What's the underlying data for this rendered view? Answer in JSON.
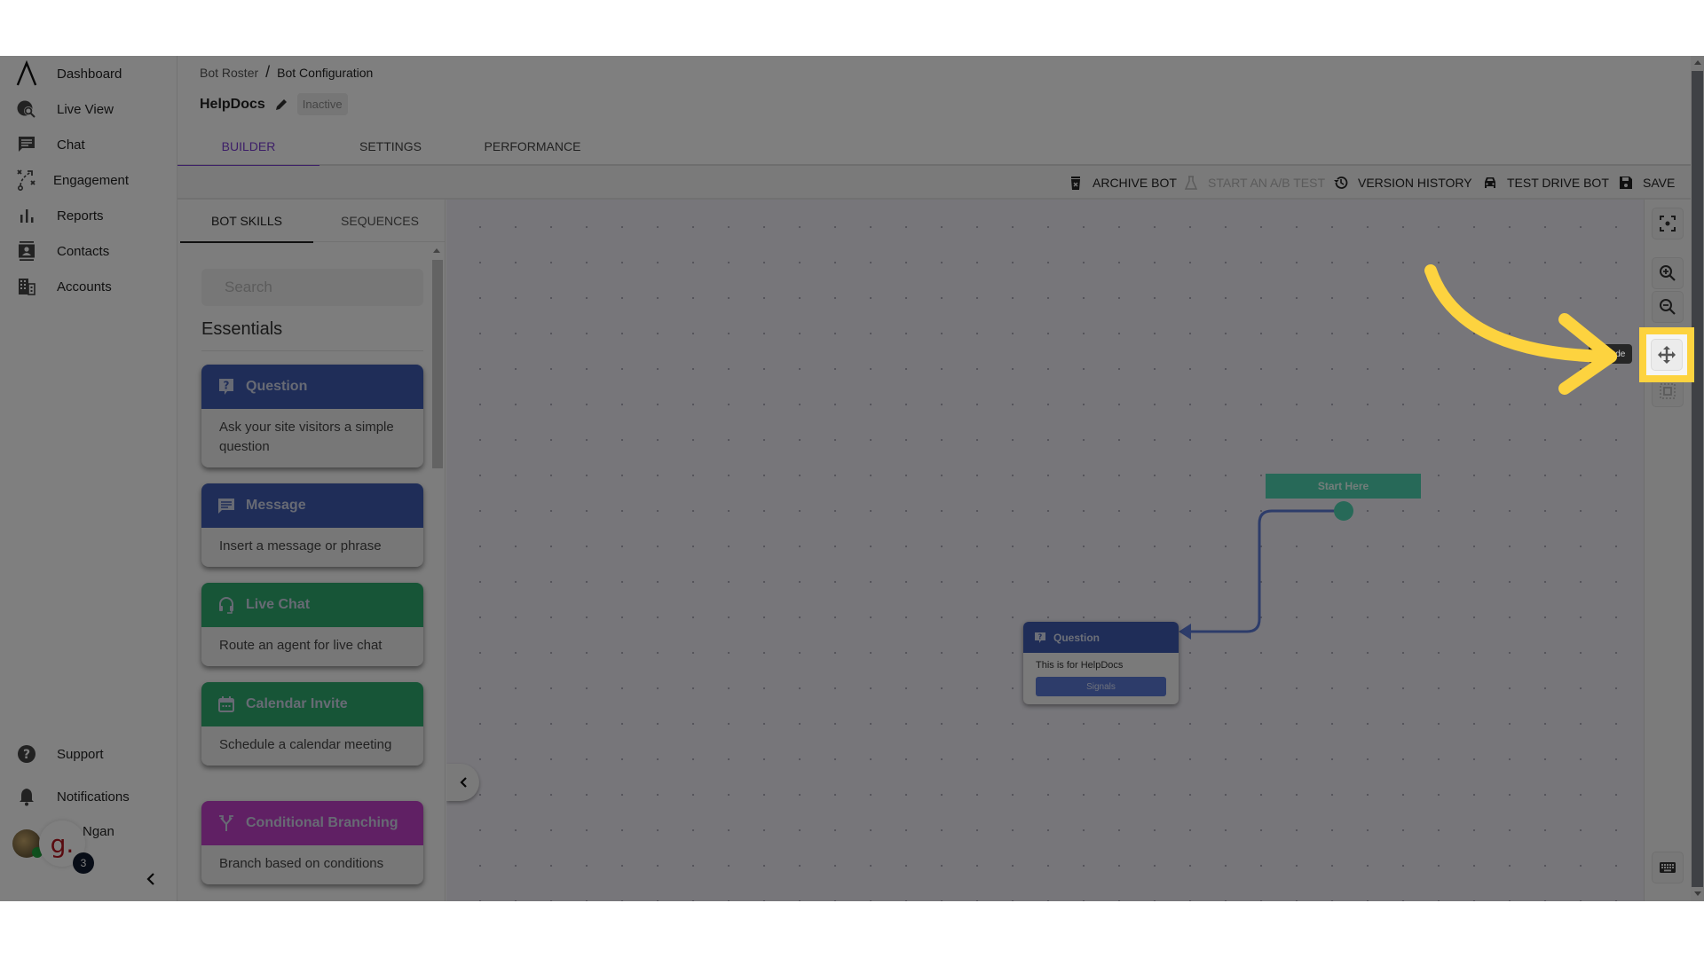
{
  "sidebar": {
    "items": [
      {
        "label": "Dashboard",
        "icon": "logo-icon"
      },
      {
        "label": "Live View",
        "icon": "globe-search-icon"
      },
      {
        "label": "Chat",
        "icon": "chat-icon"
      },
      {
        "label": "Engagement",
        "icon": "strategy-icon"
      },
      {
        "label": "Reports",
        "icon": "bar-chart-icon"
      },
      {
        "label": "Contacts",
        "icon": "contact-card-icon"
      },
      {
        "label": "Accounts",
        "icon": "building-icon"
      }
    ],
    "bottom": [
      {
        "label": "Support",
        "icon": "help-icon"
      },
      {
        "label": "Notifications",
        "icon": "bell-icon"
      }
    ],
    "user": {
      "name": "Ngan",
      "brand_letter": "g.",
      "badge_count": "3"
    },
    "collapse_glyph": "‹"
  },
  "header": {
    "breadcrumb": [
      "Bot Roster",
      "Bot Configuration"
    ],
    "breadcrumb_separator": "/",
    "bot_name": "HelpDocs",
    "status": "Inactive"
  },
  "tabs": [
    {
      "label": "BUILDER",
      "active": true
    },
    {
      "label": "SETTINGS",
      "active": false
    },
    {
      "label": "PERFORMANCE",
      "active": false
    }
  ],
  "toolbar": {
    "archive": "ARCHIVE BOT",
    "ab_test": "START AN A/B TEST",
    "version_history": "VERSION HISTORY",
    "test_drive": "TEST DRIVE BOT",
    "save": "SAVE"
  },
  "skills_panel": {
    "tabs": [
      {
        "label": "BOT SKILLS",
        "active": true
      },
      {
        "label": "SEQUENCES",
        "active": false
      }
    ],
    "search_placeholder": "Search",
    "section_title": "Essentials",
    "cards": [
      {
        "title": "Question",
        "desc": "Ask your site visitors a simple question",
        "color": "#3e5bb0",
        "icon": "question-bubble-icon"
      },
      {
        "title": "Message",
        "desc": "Insert a message or phrase",
        "color": "#3e5bb0",
        "icon": "message-icon"
      },
      {
        "title": "Live Chat",
        "desc": "Route an agent for live chat",
        "color": "#2faa6e",
        "icon": "headset-icon"
      },
      {
        "title": "Calendar Invite",
        "desc": "Schedule a calendar meeting",
        "color": "#2faa6e",
        "icon": "calendar-icon"
      },
      {
        "title": "Conditional Branching",
        "desc": "Branch based on conditions",
        "color": "#c040c8",
        "icon": "branch-icon"
      }
    ]
  },
  "canvas": {
    "start_node": "Start Here",
    "question_node": {
      "title": "Question",
      "text": "This is for HelpDocs",
      "button": "Signals"
    }
  },
  "controls": {
    "tooltip": "Pan Mode",
    "tooltip_visible": "n Mode"
  },
  "colors": {
    "accent": "#7b3fd1",
    "highlight": "#fdd33f",
    "start_node": "#4fd2b0",
    "question_node": "#3e5bb0"
  }
}
